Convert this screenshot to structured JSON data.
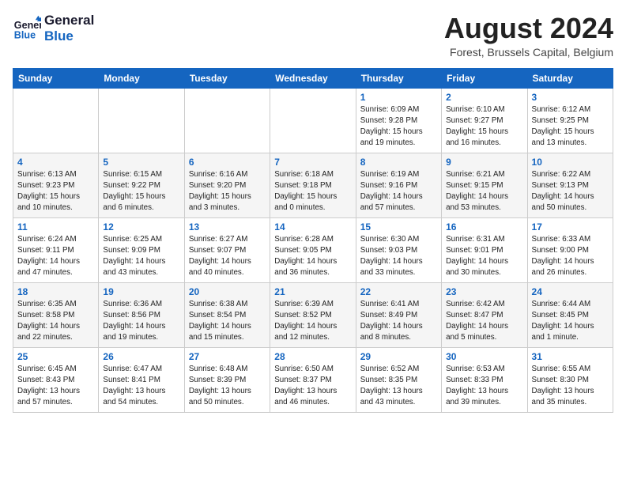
{
  "logo": {
    "line1": "General",
    "line2": "Blue"
  },
  "title": "August 2024",
  "location": "Forest, Brussels Capital, Belgium",
  "weekdays": [
    "Sunday",
    "Monday",
    "Tuesday",
    "Wednesday",
    "Thursday",
    "Friday",
    "Saturday"
  ],
  "weeks": [
    [
      {
        "day": "",
        "info": ""
      },
      {
        "day": "",
        "info": ""
      },
      {
        "day": "",
        "info": ""
      },
      {
        "day": "",
        "info": ""
      },
      {
        "day": "1",
        "info": "Sunrise: 6:09 AM\nSunset: 9:28 PM\nDaylight: 15 hours\nand 19 minutes."
      },
      {
        "day": "2",
        "info": "Sunrise: 6:10 AM\nSunset: 9:27 PM\nDaylight: 15 hours\nand 16 minutes."
      },
      {
        "day": "3",
        "info": "Sunrise: 6:12 AM\nSunset: 9:25 PM\nDaylight: 15 hours\nand 13 minutes."
      }
    ],
    [
      {
        "day": "4",
        "info": "Sunrise: 6:13 AM\nSunset: 9:23 PM\nDaylight: 15 hours\nand 10 minutes."
      },
      {
        "day": "5",
        "info": "Sunrise: 6:15 AM\nSunset: 9:22 PM\nDaylight: 15 hours\nand 6 minutes."
      },
      {
        "day": "6",
        "info": "Sunrise: 6:16 AM\nSunset: 9:20 PM\nDaylight: 15 hours\nand 3 minutes."
      },
      {
        "day": "7",
        "info": "Sunrise: 6:18 AM\nSunset: 9:18 PM\nDaylight: 15 hours\nand 0 minutes."
      },
      {
        "day": "8",
        "info": "Sunrise: 6:19 AM\nSunset: 9:16 PM\nDaylight: 14 hours\nand 57 minutes."
      },
      {
        "day": "9",
        "info": "Sunrise: 6:21 AM\nSunset: 9:15 PM\nDaylight: 14 hours\nand 53 minutes."
      },
      {
        "day": "10",
        "info": "Sunrise: 6:22 AM\nSunset: 9:13 PM\nDaylight: 14 hours\nand 50 minutes."
      }
    ],
    [
      {
        "day": "11",
        "info": "Sunrise: 6:24 AM\nSunset: 9:11 PM\nDaylight: 14 hours\nand 47 minutes."
      },
      {
        "day": "12",
        "info": "Sunrise: 6:25 AM\nSunset: 9:09 PM\nDaylight: 14 hours\nand 43 minutes."
      },
      {
        "day": "13",
        "info": "Sunrise: 6:27 AM\nSunset: 9:07 PM\nDaylight: 14 hours\nand 40 minutes."
      },
      {
        "day": "14",
        "info": "Sunrise: 6:28 AM\nSunset: 9:05 PM\nDaylight: 14 hours\nand 36 minutes."
      },
      {
        "day": "15",
        "info": "Sunrise: 6:30 AM\nSunset: 9:03 PM\nDaylight: 14 hours\nand 33 minutes."
      },
      {
        "day": "16",
        "info": "Sunrise: 6:31 AM\nSunset: 9:01 PM\nDaylight: 14 hours\nand 30 minutes."
      },
      {
        "day": "17",
        "info": "Sunrise: 6:33 AM\nSunset: 9:00 PM\nDaylight: 14 hours\nand 26 minutes."
      }
    ],
    [
      {
        "day": "18",
        "info": "Sunrise: 6:35 AM\nSunset: 8:58 PM\nDaylight: 14 hours\nand 22 minutes."
      },
      {
        "day": "19",
        "info": "Sunrise: 6:36 AM\nSunset: 8:56 PM\nDaylight: 14 hours\nand 19 minutes."
      },
      {
        "day": "20",
        "info": "Sunrise: 6:38 AM\nSunset: 8:54 PM\nDaylight: 14 hours\nand 15 minutes."
      },
      {
        "day": "21",
        "info": "Sunrise: 6:39 AM\nSunset: 8:52 PM\nDaylight: 14 hours\nand 12 minutes."
      },
      {
        "day": "22",
        "info": "Sunrise: 6:41 AM\nSunset: 8:49 PM\nDaylight: 14 hours\nand 8 minutes."
      },
      {
        "day": "23",
        "info": "Sunrise: 6:42 AM\nSunset: 8:47 PM\nDaylight: 14 hours\nand 5 minutes."
      },
      {
        "day": "24",
        "info": "Sunrise: 6:44 AM\nSunset: 8:45 PM\nDaylight: 14 hours\nand 1 minute."
      }
    ],
    [
      {
        "day": "25",
        "info": "Sunrise: 6:45 AM\nSunset: 8:43 PM\nDaylight: 13 hours\nand 57 minutes."
      },
      {
        "day": "26",
        "info": "Sunrise: 6:47 AM\nSunset: 8:41 PM\nDaylight: 13 hours\nand 54 minutes."
      },
      {
        "day": "27",
        "info": "Sunrise: 6:48 AM\nSunset: 8:39 PM\nDaylight: 13 hours\nand 50 minutes."
      },
      {
        "day": "28",
        "info": "Sunrise: 6:50 AM\nSunset: 8:37 PM\nDaylight: 13 hours\nand 46 minutes."
      },
      {
        "day": "29",
        "info": "Sunrise: 6:52 AM\nSunset: 8:35 PM\nDaylight: 13 hours\nand 43 minutes."
      },
      {
        "day": "30",
        "info": "Sunrise: 6:53 AM\nSunset: 8:33 PM\nDaylight: 13 hours\nand 39 minutes."
      },
      {
        "day": "31",
        "info": "Sunrise: 6:55 AM\nSunset: 8:30 PM\nDaylight: 13 hours\nand 35 minutes."
      }
    ]
  ]
}
